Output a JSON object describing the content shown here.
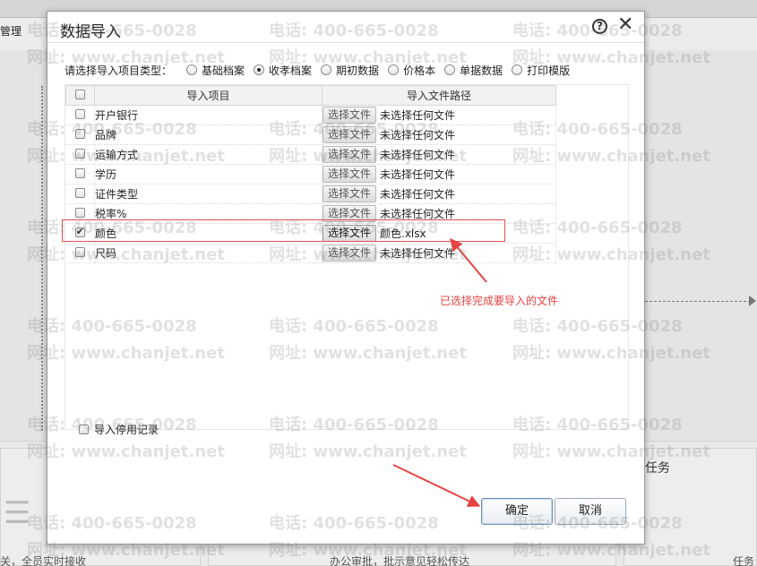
{
  "background": {
    "menu_fragment": "管理",
    "task_label": "任务",
    "bottom_text_left": "关，全员实时接收",
    "bottom_text_mid": "办公审批，批示意见轻松传达",
    "bottom_text_right": "任务"
  },
  "watermark": {
    "phone": "电话: 400-665-0028",
    "site": "网址: www.chanjet.net"
  },
  "dialog": {
    "title": "数据导入",
    "help_icon": "help-icon",
    "close_icon": "close-icon",
    "type_label": "请选择导入项目类型：",
    "type_options": [
      {
        "label": "基础档案",
        "selected": false
      },
      {
        "label": "收孝档案",
        "selected": true
      },
      {
        "label": "期初数据",
        "selected": false
      },
      {
        "label": "价格本",
        "selected": false
      },
      {
        "label": "单据数据",
        "selected": false
      },
      {
        "label": "打印模版",
        "selected": false
      }
    ],
    "columns": {
      "item": "导入项目",
      "path": "导入文件路径"
    },
    "file_button": "选择文件",
    "rows": [
      {
        "name": "开户银行",
        "checked": false,
        "file": "未选择任何文件"
      },
      {
        "name": "品牌",
        "checked": false,
        "file": "未选择任何文件"
      },
      {
        "name": "运输方式",
        "checked": false,
        "file": "未选择任何文件"
      },
      {
        "name": "学历",
        "checked": false,
        "file": "未选择任何文件"
      },
      {
        "name": "证件类型",
        "checked": false,
        "file": "未选择任何文件"
      },
      {
        "name": "税率%",
        "checked": false,
        "file": "未选择任何文件"
      },
      {
        "name": "颜色",
        "checked": true,
        "file": "颜色.xlsx"
      },
      {
        "name": "尺码",
        "checked": false,
        "file": "未选择任何文件"
      }
    ],
    "annotation": "已选择完成要导入的文件",
    "include_disabled_label": "导入停用记录",
    "ok_label": "确定",
    "cancel_label": "取消",
    "accent_color": "#e05050"
  }
}
